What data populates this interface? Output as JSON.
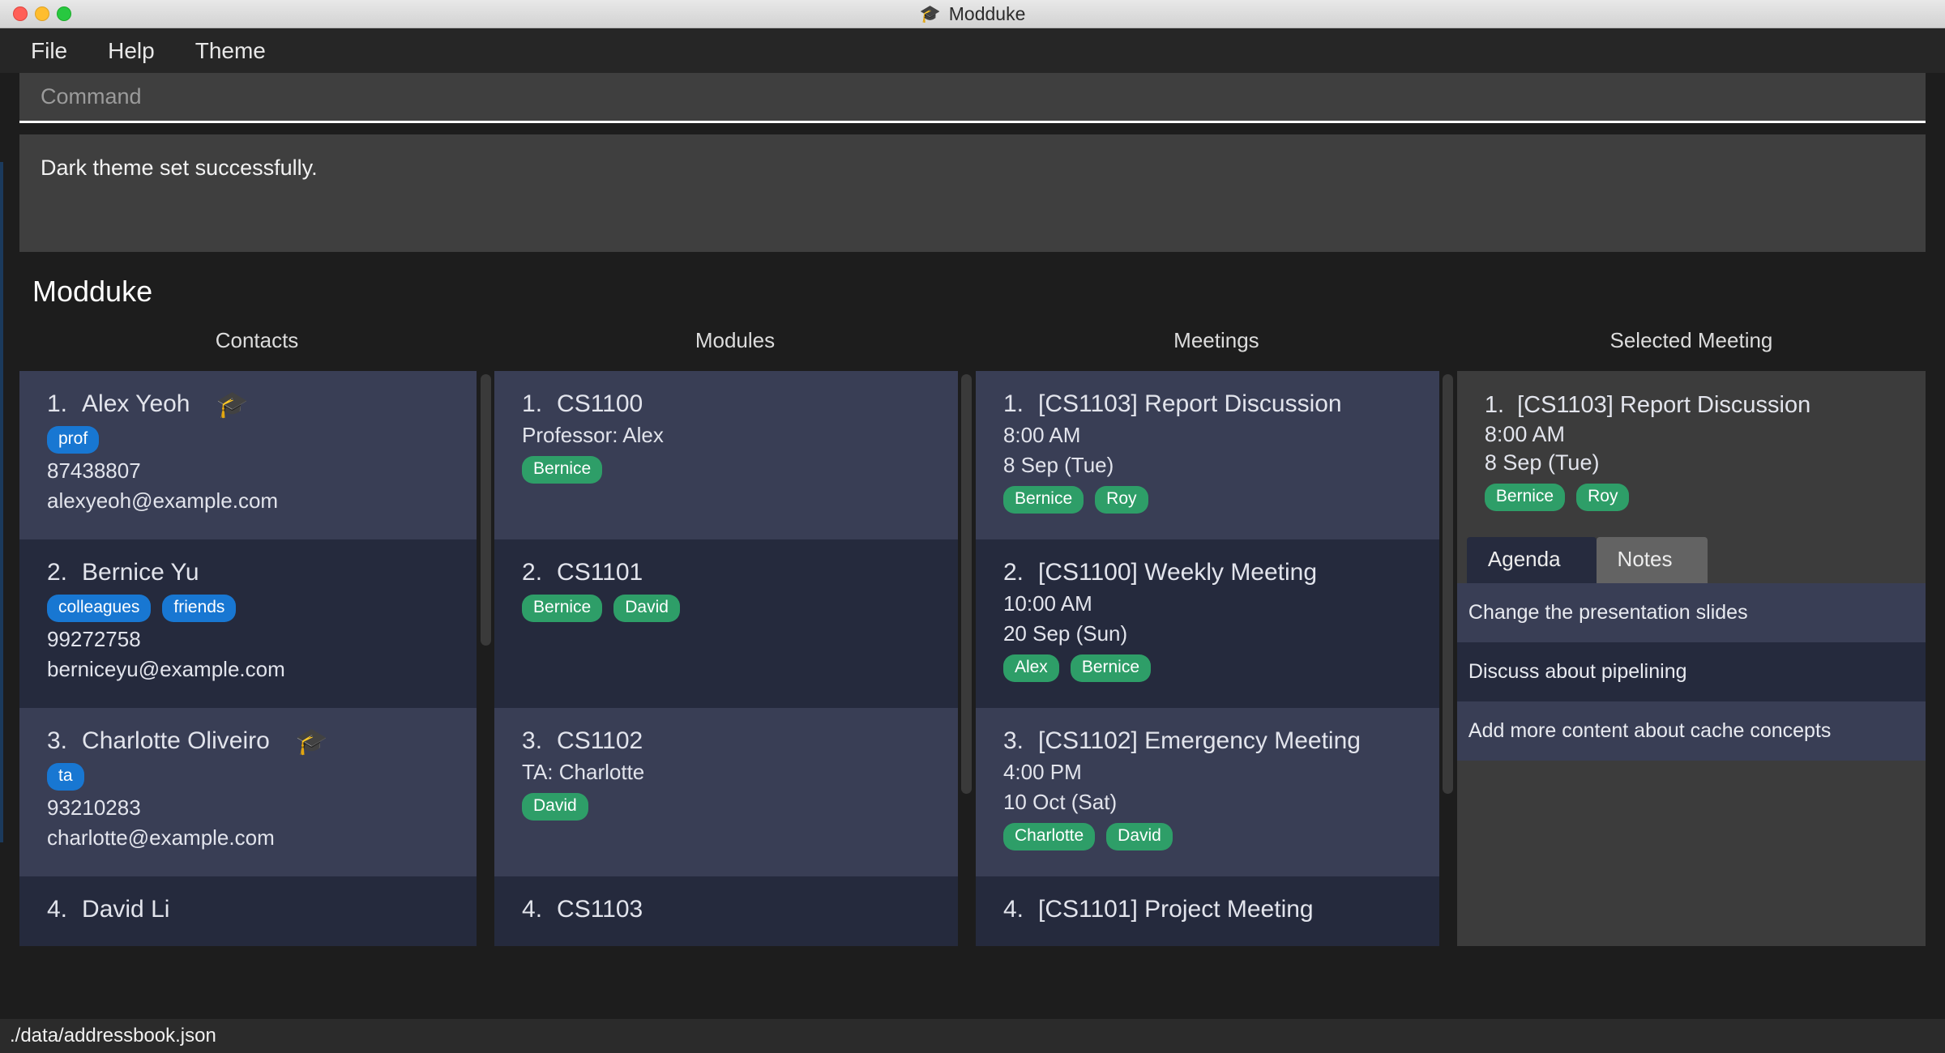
{
  "window": {
    "title": "Modduke",
    "icon": "graduation-cap-icon",
    "traffic_lights": [
      "close",
      "minimize",
      "maximize"
    ]
  },
  "menubar": {
    "items": [
      {
        "label": "File"
      },
      {
        "label": "Help"
      },
      {
        "label": "Theme"
      }
    ]
  },
  "command": {
    "placeholder": "Command",
    "value": ""
  },
  "result": {
    "message": "Dark theme set successfully."
  },
  "app": {
    "title": "Modduke"
  },
  "columns": {
    "contacts_header": "Contacts",
    "modules_header": "Modules",
    "meetings_header": "Meetings",
    "selected_header": "Selected Meeting"
  },
  "contacts": [
    {
      "index": "1.",
      "name": "Alex Yeoh",
      "icon": "graduation-cap-icon",
      "tags": [
        "prof"
      ],
      "phone": "87438807",
      "email": "alexyeoh@example.com"
    },
    {
      "index": "2.",
      "name": "Bernice Yu",
      "icon": "",
      "tags": [
        "colleagues",
        "friends"
      ],
      "phone": "99272758",
      "email": "berniceyu@example.com"
    },
    {
      "index": "3.",
      "name": "Charlotte Oliveiro",
      "icon": "graduation-cap-icon",
      "tags": [
        "ta"
      ],
      "phone": "93210283",
      "email": "charlotte@example.com"
    },
    {
      "index": "4.",
      "name": "David Li",
      "icon": "",
      "tags": [],
      "phone": "",
      "email": ""
    }
  ],
  "modules": [
    {
      "index": "1.",
      "code": "CS1100",
      "role": "Professor: Alex",
      "members": [
        "Bernice"
      ]
    },
    {
      "index": "2.",
      "code": "CS1101",
      "role": "",
      "members": [
        "Bernice",
        "David"
      ]
    },
    {
      "index": "3.",
      "code": "CS1102",
      "role": "TA: Charlotte",
      "members": [
        "David"
      ]
    },
    {
      "index": "4.",
      "code": "CS1103",
      "role": "",
      "members": []
    }
  ],
  "meetings": [
    {
      "index": "1.",
      "name": "[CS1103] Report Discussion",
      "time": "8:00 AM",
      "date": "8 Sep (Tue)",
      "members": [
        "Bernice",
        "Roy"
      ]
    },
    {
      "index": "2.",
      "name": "[CS1100] Weekly Meeting",
      "time": "10:00 AM",
      "date": "20 Sep (Sun)",
      "members": [
        "Alex",
        "Bernice"
      ]
    },
    {
      "index": "3.",
      "name": "[CS1102] Emergency Meeting",
      "time": "4:00 PM",
      "date": "10 Oct (Sat)",
      "members": [
        "Charlotte",
        "David"
      ]
    },
    {
      "index": "4.",
      "name": "[CS1101] Project Meeting",
      "time": "",
      "date": "",
      "members": []
    }
  ],
  "selected_meeting": {
    "index": "1.",
    "name": "[CS1103] Report Discussion",
    "time": "8:00 AM",
    "date": "8 Sep (Tue)",
    "members": [
      "Bernice",
      "Roy"
    ],
    "tabs": [
      {
        "label": "Agenda",
        "active": true
      },
      {
        "label": "Notes",
        "active": false
      }
    ],
    "agenda": [
      "Change the presentation slides",
      "Discuss about pipelining",
      "Add more content about cache concepts"
    ]
  },
  "statusbar": {
    "path": "./data/addressbook.json"
  },
  "colors": {
    "tag_blue": "#1877d2",
    "tag_green": "#2e9e68",
    "card_odd": "#393e55",
    "card_even": "#252a3d",
    "background": "#1d1d1d",
    "panel": "#3f3f3f",
    "accent_cap": "#f6a118"
  }
}
